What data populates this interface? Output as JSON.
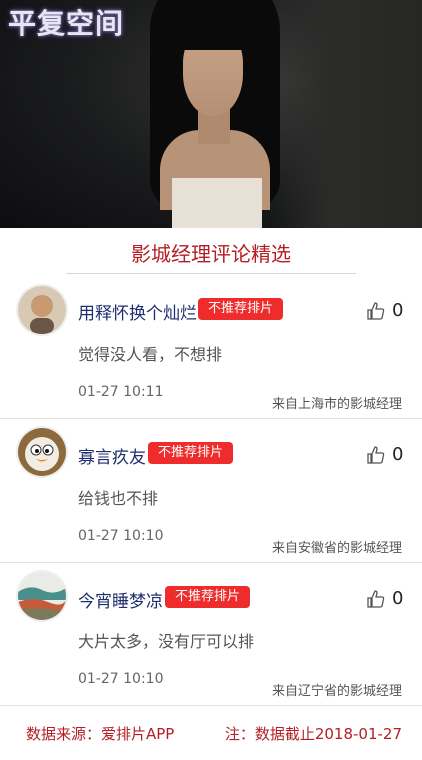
{
  "hero": {
    "logo_text": "平复空间"
  },
  "section_title": "影城经理评论精选",
  "comments": [
    {
      "username": "用释怀换个灿烂",
      "badge": "不推荐排片",
      "likes": "0",
      "text": "觉得没人看，不想排",
      "time": "01-27 10:11",
      "source": "来自上海市的影城经理",
      "avatar_icon": "avatar-man-portrait"
    },
    {
      "username": "寡言疚友",
      "badge": "不推荐排片",
      "likes": "0",
      "text": "给钱也不排",
      "time": "01-27 10:10",
      "source": "来自安徽省的影城经理",
      "avatar_icon": "avatar-cartoon-bird"
    },
    {
      "username": "今宵睡梦凉",
      "badge": "不推荐排片",
      "likes": "0",
      "text": "大片太多，没有厅可以排",
      "time": "01-27 10:10",
      "source": "来自辽宁省的影城经理",
      "avatar_icon": "avatar-painting"
    }
  ],
  "footer": {
    "source": "数据来源：爱排片APP",
    "note": "注：数据截止2018-01-27"
  },
  "colors": {
    "accent_red": "#b41e24",
    "badge_red": "#ee2c2c",
    "username_blue": "#1f2f6b"
  }
}
